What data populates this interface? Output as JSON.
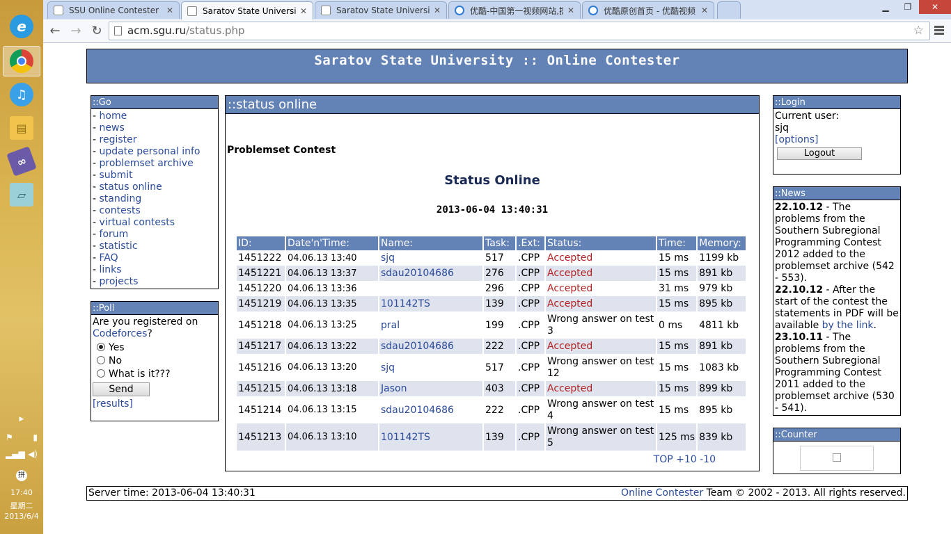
{
  "taskbar": {
    "icons": [
      "ie-icon",
      "chrome-icon",
      "itunes-icon",
      "file-explorer-icon",
      "visual-studio-icon",
      "notebook-icon"
    ],
    "clock_time": "17:40",
    "clock_day": "星期二",
    "clock_date": "2013/6/4",
    "ime_label": "拼"
  },
  "browser": {
    "tabs": [
      {
        "label": "SSU Online Contester ::"
      },
      {
        "label": "Saratov State University"
      },
      {
        "label": "Saratov State University"
      },
      {
        "label": "优酷-中国第一视频网站,提"
      },
      {
        "label": "优酷原创首页 - 优酷视频"
      }
    ],
    "url_host": "acm.sgu.ru",
    "url_path": "/status.php"
  },
  "header": {
    "title": "Saratov State University :: Online Contester"
  },
  "go": {
    "title": "::Go",
    "items": [
      "home",
      "news",
      "register",
      "update personal info",
      "problemset archive",
      "submit",
      "status online",
      "standing",
      "contests",
      "virtual contests",
      "forum",
      "statistic",
      "FAQ",
      "links",
      "projects"
    ]
  },
  "poll": {
    "title": "::Poll",
    "question_prefix": "Are you registered on",
    "question_link": "Codeforces",
    "question_suffix": "?",
    "options": [
      "Yes",
      "No",
      "What is it???"
    ],
    "selected": "Yes",
    "send_label": "Send",
    "results_label": "[results]"
  },
  "main": {
    "title": "::status online",
    "subtitle": "Problemset Contest",
    "heading": "Status Online",
    "time": "2013-06-04 13:40:31",
    "columns": [
      "ID:",
      "Date'n'Time:",
      "Name:",
      "Task:",
      ".Ext:",
      "Status:",
      "Time:",
      "Memory:"
    ],
    "rows": [
      {
        "id": "1451222",
        "dt": "04.06.13 13:40",
        "name": "sjq",
        "task": "517",
        "ext": ".CPP",
        "status": "Accepted",
        "time": "15 ms",
        "mem": "1199 kb"
      },
      {
        "id": "1451221",
        "dt": "04.06.13 13:37",
        "name": "sdau20104686",
        "task": "276",
        "ext": ".CPP",
        "status": "Accepted",
        "time": "15 ms",
        "mem": "891 kb"
      },
      {
        "id": "1451220",
        "dt": "04.06.13 13:36",
        "name": "",
        "task": "296",
        "ext": ".CPP",
        "status": "Accepted",
        "time": "31 ms",
        "mem": "979 kb"
      },
      {
        "id": "1451219",
        "dt": "04.06.13 13:35",
        "name": "101142TS",
        "task": "139",
        "ext": ".CPP",
        "status": "Accepted",
        "time": "15 ms",
        "mem": "895 kb"
      },
      {
        "id": "1451218",
        "dt": "04.06.13 13:25",
        "name": "pral",
        "task": "199",
        "ext": ".CPP",
        "status": "Wrong answer on test 3",
        "time": "0 ms",
        "mem": "4811 kb"
      },
      {
        "id": "1451217",
        "dt": "04.06.13 13:22",
        "name": "sdau20104686",
        "task": "222",
        "ext": ".CPP",
        "status": "Accepted",
        "time": "15 ms",
        "mem": "891 kb"
      },
      {
        "id": "1451216",
        "dt": "04.06.13 13:20",
        "name": "sjq",
        "task": "517",
        "ext": ".CPP",
        "status": "Wrong answer on test 12",
        "time": "15 ms",
        "mem": "1083 kb"
      },
      {
        "id": "1451215",
        "dt": "04.06.13 13:18",
        "name": "Jason",
        "task": "403",
        "ext": ".CPP",
        "status": "Accepted",
        "time": "15 ms",
        "mem": "899 kb"
      },
      {
        "id": "1451214",
        "dt": "04.06.13 13:15",
        "name": "sdau20104686",
        "task": "222",
        "ext": ".CPP",
        "status": "Wrong answer on test 4",
        "time": "15 ms",
        "mem": "895 kb"
      },
      {
        "id": "1451213",
        "dt": "04.06.13 13:10",
        "name": "101142TS",
        "task": "139",
        "ext": ".CPP",
        "status": "Wrong answer on test 5",
        "time": "125 ms",
        "mem": "839 kb"
      }
    ],
    "pager": [
      "TOP",
      "+10",
      "-10"
    ]
  },
  "login": {
    "title": "::Login",
    "current_user_label": "Current user:",
    "username": "sjq",
    "options_label": "[options]",
    "logout_label": "Logout"
  },
  "news": {
    "title": "::News",
    "items": [
      {
        "date": "22.10.12",
        "text": " - The problems from the Southern Subregional Programming Contest 2012 added to the problemset archive (542 - 553)."
      },
      {
        "date": "22.10.12",
        "text": " - After the start of the contest the statements in PDF will be available ",
        "link": "by the link",
        "after": "."
      },
      {
        "date": "23.10.11",
        "text": " - The problems from the Southern Subregional Programming Contest 2011 added to the problemset archive (530 - 541)."
      }
    ]
  },
  "counter": {
    "title": "::Counter"
  },
  "footer": {
    "server_time": "Server time: 2013-06-04 13:40:31",
    "link": "Online Contester",
    "rest": " Team © 2002 - 2013. All rights reserved."
  },
  "colors": {
    "header_blue": "#6382b6",
    "accepted_red": "#b22222",
    "link_blue": "#2b4b9b"
  }
}
